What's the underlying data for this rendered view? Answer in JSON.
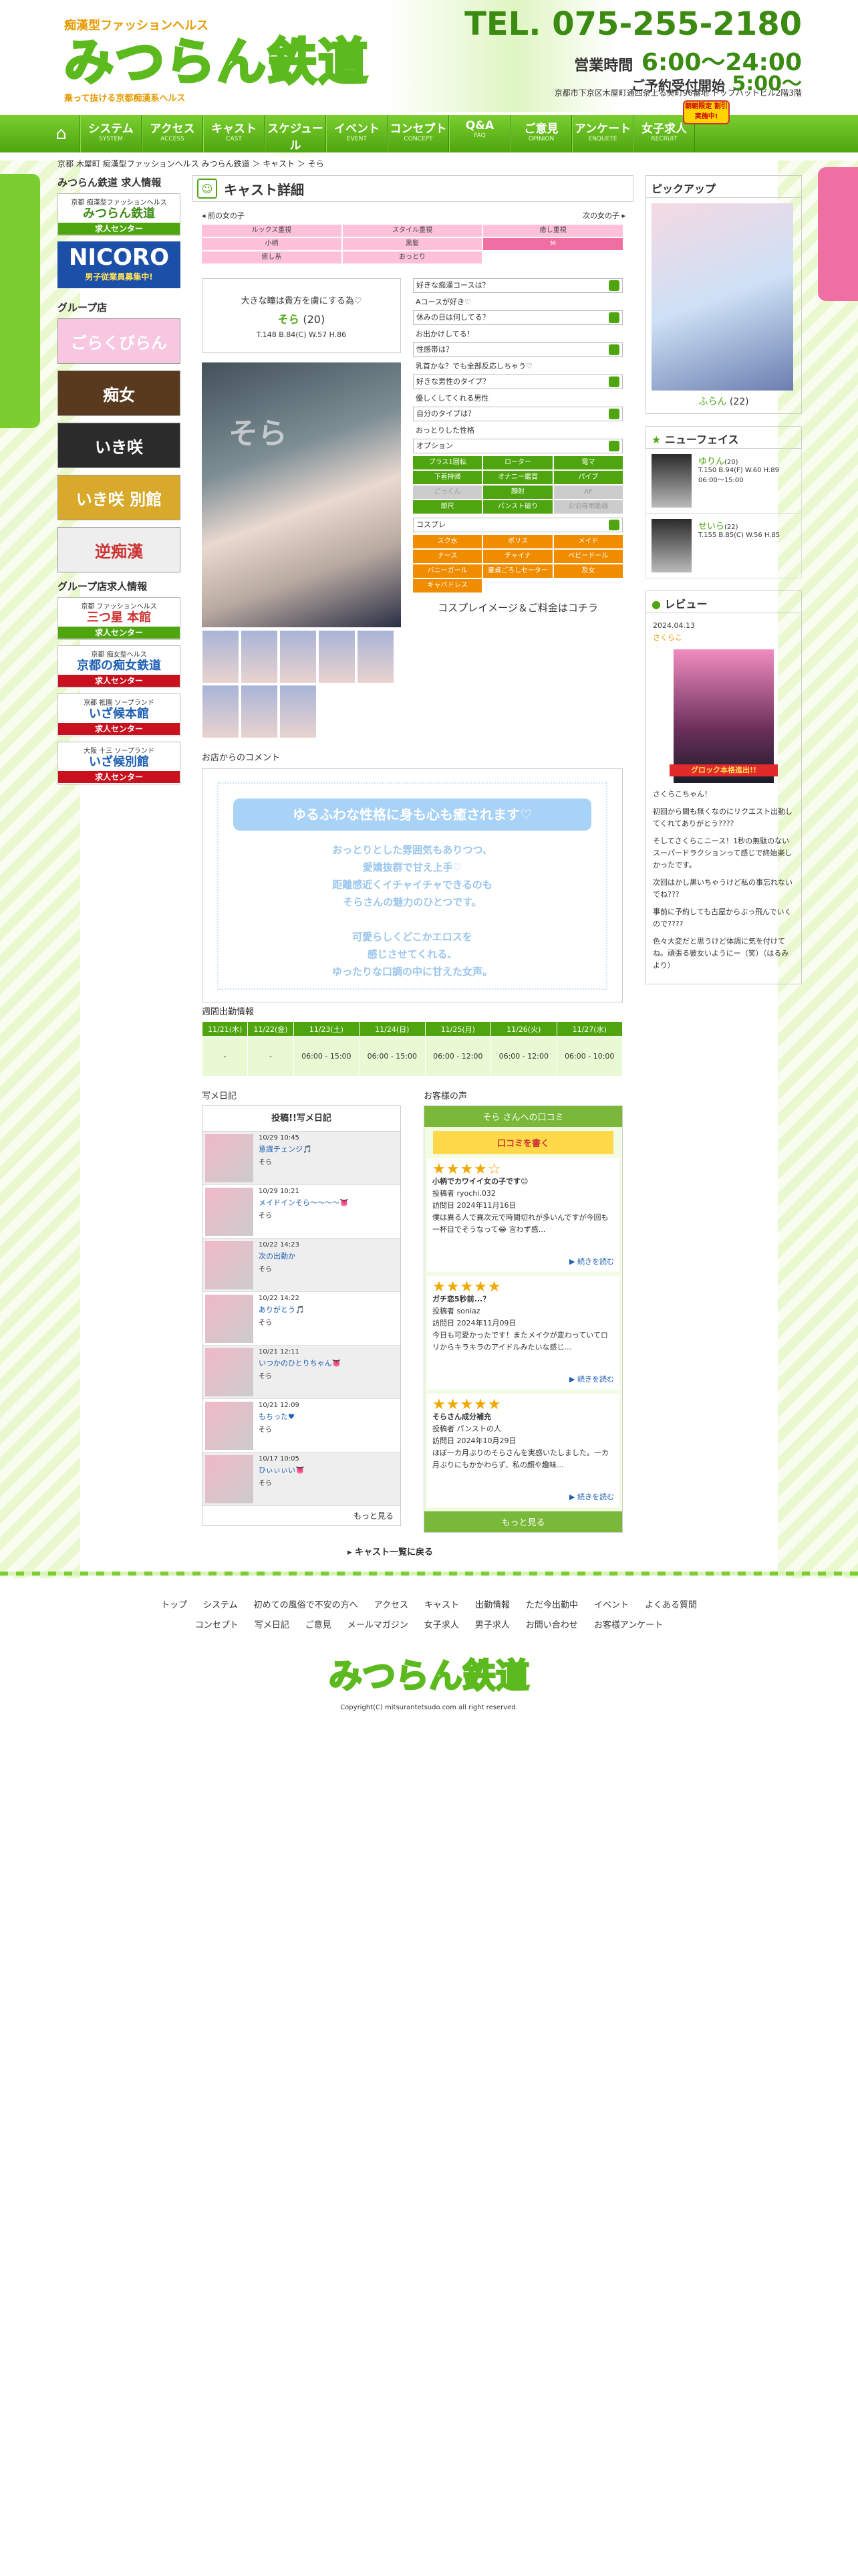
{
  "header": {
    "logo_sub": "痴漢型ファッションヘルス",
    "logo_main": "みつらん鉄道",
    "logo_tag": "乗って抜ける京都痴漢系ヘルス",
    "tel": "TEL. 075-255-2180",
    "hours_label": "営業時間",
    "hours": "6:00〜24:00",
    "recept_label": "ご予約受付開始",
    "recept": "5:00〜",
    "address": "京都市下京区木屋町通四条上る美町96番地 トップハットビル2階3階",
    "new_badge": "朝朝限定 割引実施中!"
  },
  "nav": [
    {
      "label": "システム",
      "en": "SYSTEM"
    },
    {
      "label": "アクセス",
      "en": "ACCESS"
    },
    {
      "label": "キャスト",
      "en": "CAST"
    },
    {
      "label": "スケジュール",
      "en": "SCHEDULE"
    },
    {
      "label": "イベント",
      "en": "EVENT"
    },
    {
      "label": "コンセプト",
      "en": "CONCEPT"
    },
    {
      "label": "Q&A",
      "en": "FAQ"
    },
    {
      "label": "ご意見",
      "en": "OPINION"
    },
    {
      "label": "アンケート",
      "en": "ENQUETE"
    },
    {
      "label": "女子求人",
      "en": "RECRUIT"
    }
  ],
  "breadcrumb": "京都 木屋町 痴漢型ファッションヘルス みつらん鉄道 ＞ キャスト ＞ そら",
  "left": {
    "recruit_title": "みつらん鉄道 求人情報",
    "recruit_sub": "京都 痴漢型ファッションヘルス",
    "recruit_name": "みつらん鉄道",
    "recruit_btn": "求人センター",
    "nicoro_title": "NICORO",
    "nicoro_sub": "男子従業員募集中!",
    "group_title": "グループ店",
    "banners": [
      "ごらくびらん",
      "痴女",
      "いき咲",
      "いき咲 別館",
      "逆痴漢"
    ],
    "group_recruit_title": "グループ店求人情報",
    "recruits": [
      {
        "sub": "京都 ファッションヘルス",
        "name": "三つ星 本館",
        "btn": "求人センター"
      },
      {
        "sub": "京都 痴女型ヘルス",
        "name": "京都の痴女鉄道",
        "btn": "求人センター"
      },
      {
        "sub": "京都 祇園 ソープランド",
        "name": "いざ候本館",
        "btn": "求人センター"
      },
      {
        "sub": "大阪 十三 ソープランド",
        "name": "いざ候別館",
        "btn": "求人センター"
      }
    ]
  },
  "cast": {
    "title": "キャスト詳細",
    "prev": "◂ 前の女の子",
    "next": "次の女の子 ▸",
    "tags": [
      {
        "t": "ルックス重視",
        "on": false
      },
      {
        "t": "スタイル重視",
        "on": false
      },
      {
        "t": "癒し重視",
        "on": false
      },
      {
        "t": "小柄",
        "on": false
      },
      {
        "t": "黒髪",
        "on": false
      },
      {
        "t": "M",
        "on": true
      },
      {
        "t": "癒し系",
        "on": false
      },
      {
        "t": "おっとり",
        "on": false
      }
    ],
    "quote": "大きな瞳は貴方を虜にする為♡",
    "name": "そら",
    "age": "(20)",
    "size": "T.148 B.84(C) W.57 H.86",
    "photo_text": "そら",
    "questions": [
      "好きな痴漢コースは？",
      "Aコースが好き♡",
      "休みの日は何してる？",
      "お出かけしてる！",
      "性感帯は？",
      "乳首かな？でも全部反応しちゃう♡",
      "好きな男性のタイプ？",
      "優しくしてくれる男性",
      "自分のタイプは？",
      "おっとりした性格"
    ],
    "option_label": "オプション",
    "options": [
      {
        "t": "プラス1回転",
        "on": true
      },
      {
        "t": "ローター",
        "on": true
      },
      {
        "t": "電マ",
        "on": true
      },
      {
        "t": "下着持帰",
        "on": true
      },
      {
        "t": "オナニー鑑賞",
        "on": true
      },
      {
        "t": "パイブ",
        "on": true
      },
      {
        "t": "ごっくん",
        "on": false
      },
      {
        "t": "顔射",
        "on": true
      },
      {
        "t": "AF",
        "on": false
      },
      {
        "t": "即尺",
        "on": true
      },
      {
        "t": "パンスト破り",
        "on": true
      },
      {
        "t": "お泊専用動画",
        "on": false
      }
    ],
    "cos_label": "コスプレ",
    "cosplay": [
      "スク水",
      "ポリス",
      "メイド",
      "ナース",
      "チャイナ",
      "ベビードール",
      "バニーガール",
      "童貞ごろしセーター",
      "及女",
      "キャバドレス"
    ],
    "cos_msg": "コスプレイメージ＆ご料金はコチラ"
  },
  "comment": {
    "title": "お店からのコメント",
    "head": "ゆるふわな性格に身も心も癒されます♡",
    "lines": [
      "おっとりとした雰囲気もありつつ、",
      "愛嬌抜群で甘え上手♡",
      "距離感近くイチャイチャできるのも",
      "そらさんの魅力のひとつです。",
      "",
      "可愛らしくどこかエロスを",
      "感じさせてくれる、",
      "ゆったりな口調の中に甘えた女声。"
    ]
  },
  "schedule": {
    "title": "週間出勤情報",
    "days": [
      "11/21(木)",
      "11/22(金)",
      "11/23(土)",
      "11/24(日)",
      "11/25(月)",
      "11/26(火)",
      "11/27(水)"
    ],
    "times": [
      "-",
      "-",
      "06:00 - 15:00",
      "06:00 - 15:00",
      "06:00 - 12:00",
      "06:00 - 12:00",
      "06:00 - 10:00"
    ]
  },
  "diary": {
    "title": "写メ日記",
    "box_title": "投稿!!写メ日記",
    "posts": [
      {
        "d": "10/29 10:45",
        "t": "意識チェンジ🎵",
        "n": "そら"
      },
      {
        "d": "10/29 10:21",
        "t": "メイドインそら〜〜〜〜👅",
        "n": "そら"
      },
      {
        "d": "10/22 14:23",
        "t": "次の出勤か",
        "n": "そら"
      },
      {
        "d": "10/22 14:22",
        "t": "ありがとう🎵",
        "n": "そら"
      },
      {
        "d": "10/21 12:11",
        "t": "いつかのひとりちゃん👅",
        "n": "そら"
      },
      {
        "d": "10/21 12:09",
        "t": "もちった♥",
        "n": "そら"
      },
      {
        "d": "10/17 10:05",
        "t": "ひぃぃぃい👅",
        "n": "そら"
      }
    ],
    "more": "もっと見る"
  },
  "reviews": {
    "title": "お客様の声",
    "head": "そら さんへの口コミ",
    "btn": "口コミを書く",
    "items": [
      {
        "stars": "★★★★☆",
        "title": "小柄でカワイイ女の子です😊",
        "user": "投稿者 ryochi.032",
        "date": "訪問日 2024年11月16日",
        "body": "僕は異る人で異次元で時間切れが多いんですが今回も一杯目でそうなって😂 言わず感...",
        "more": "▶ 続きを読む"
      },
      {
        "stars": "★★★★★",
        "title": "ガチ恋5秒前...？",
        "user": "投稿者 soniaz",
        "date": "訪問日 2024年11月09日",
        "body": "今日も可愛かったです！またメイクが変わっていてロリからキラキラのアイドルみたいな感じ...",
        "more": "▶ 続きを読む"
      },
      {
        "stars": "★★★★★",
        "title": "そらさん成分補充",
        "user": "投稿者 パンストの人",
        "date": "訪問日 2024年10月29日",
        "body": "ほぼ一カ月ぶりのそらさんを実感いたしました。一カ月ぶりにもかかわらず、私の顔や趣味...",
        "more": "▶ 続きを読む"
      }
    ],
    "more": "もっと見る"
  },
  "back": "▸ キャスト一覧に戻る",
  "right": {
    "pickup_title": "ピックアップ",
    "pickup_name": "ふらん",
    "pickup_age": "(22)",
    "newface_title": "ニューフェイス",
    "newfaces": [
      {
        "name": "ゆりん",
        "age": "(20)",
        "size": "T.150 B.94(F) W.60 H.89",
        "time": "06:00〜15:00"
      },
      {
        "name": "せいら",
        "age": "(22)",
        "size": "T.155 B.85(C) W.56 H.85",
        "time": ""
      }
    ],
    "review_title": "レビュー",
    "review_date": "2024.04.13",
    "review_name": "さくらこ",
    "review_badge": "グロック本格進出!!",
    "review_text": [
      "さくらこちゃん！",
      "初回から間も無くなのにリクエスト出勤してくれてありがとう????",
      "そしてさくらこニース！1秒の無駄のないスーパードラクションって感じで終始楽しかったです。",
      "次回はかし黒いちゃうけど私の事忘れないでね???",
      "事前に予約しても古屋からぶっ飛んでいくので????",
      "色々大変だと思うけど体調に気を付けてね。頑張る彼女いようにー（笑）（はるみより）"
    ]
  },
  "footer": {
    "links1": [
      "トップ",
      "システム",
      "初めての風俗で不安の方へ",
      "アクセス",
      "キャスト",
      "出勤情報",
      "ただ今出勤中",
      "イベント",
      "よくある質問"
    ],
    "links2": [
      "コンセプト",
      "写メ日記",
      "ご意見",
      "メールマガジン",
      "女子求人",
      "男子求人",
      "お問い合わせ",
      "お客様アンケート"
    ],
    "logo": "みつらん鉄道",
    "copyright": "Copyright(C) mitsurantetsudo.com all right reserved."
  },
  "colors": {
    "brand": "#4ea50f",
    "accent": "#f06fa3",
    "orange": "#f08c00"
  }
}
